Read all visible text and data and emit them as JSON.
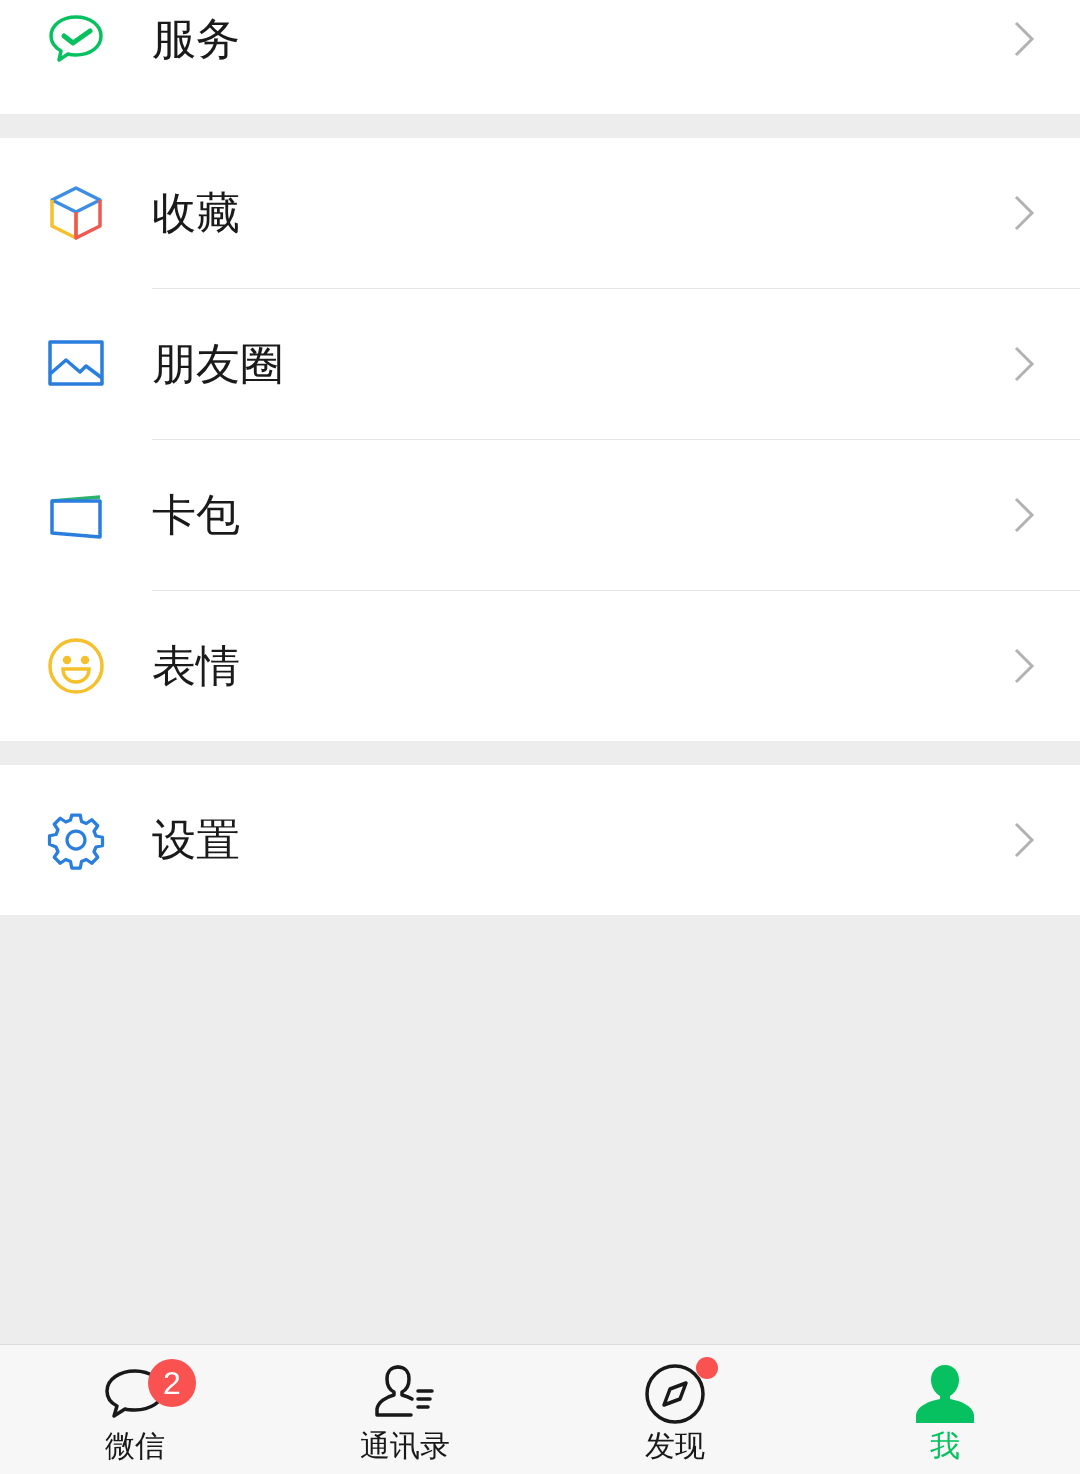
{
  "sections": [
    {
      "items": [
        {
          "kind": "service",
          "label": "服务"
        }
      ]
    },
    {
      "items": [
        {
          "kind": "favorites",
          "label": "收藏"
        },
        {
          "kind": "moments",
          "label": "朋友圈"
        },
        {
          "kind": "cards",
          "label": "卡包"
        },
        {
          "kind": "stickers",
          "label": "表情"
        }
      ]
    },
    {
      "items": [
        {
          "kind": "settings",
          "label": "设置"
        }
      ]
    }
  ],
  "tab_bar": [
    {
      "kind": "chats",
      "label": "微信",
      "badge": "2",
      "dot": false,
      "selected": false
    },
    {
      "kind": "contacts",
      "label": "通讯录",
      "dot": false,
      "selected": false
    },
    {
      "kind": "discover",
      "label": "发现",
      "dot": true,
      "selected": false
    },
    {
      "kind": "me",
      "label": "我",
      "dot": false,
      "selected": true
    }
  ]
}
